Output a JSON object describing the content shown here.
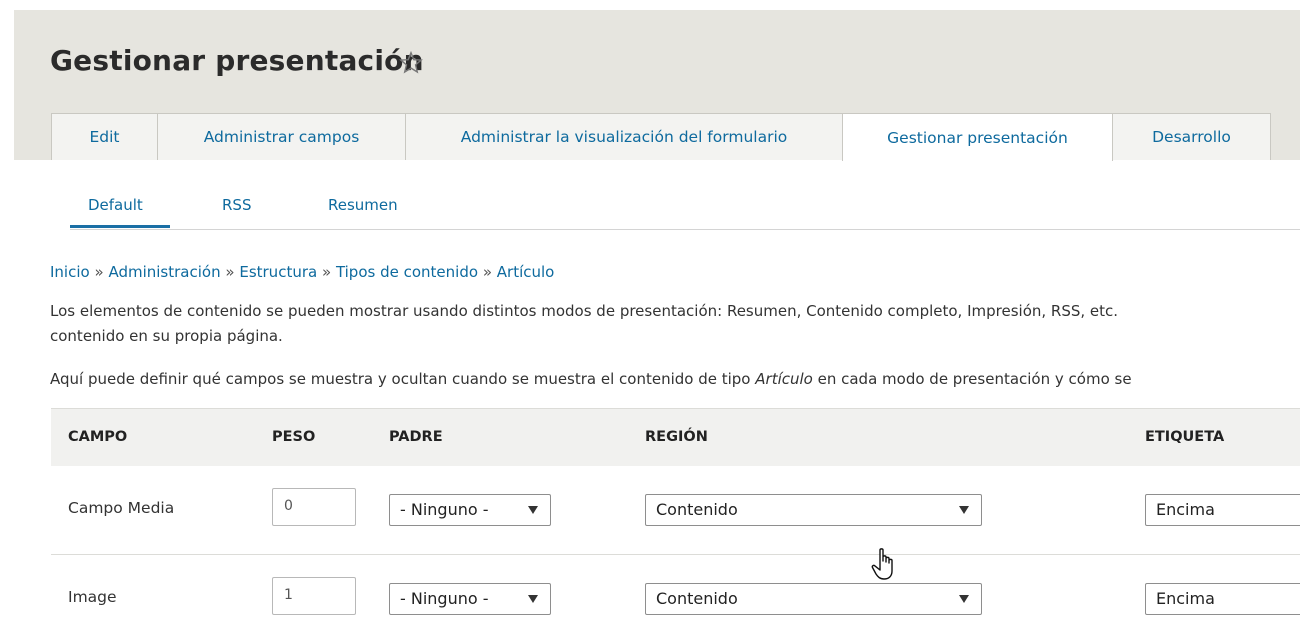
{
  "page": {
    "title": "Gestionar presentación",
    "star_icon": "star-outline-icon"
  },
  "tabs": [
    {
      "label": "Edit"
    },
    {
      "label": "Administrar campos"
    },
    {
      "label": "Administrar la visualización del formulario"
    },
    {
      "label": "Gestionar presentación",
      "active": true
    },
    {
      "label": "Desarrollo"
    }
  ],
  "subtabs": [
    {
      "label": "Default",
      "active": true
    },
    {
      "label": "RSS"
    },
    {
      "label": "Resumen"
    }
  ],
  "breadcrumb": {
    "items": [
      "Inicio",
      "Administración",
      "Estructura",
      "Tipos de contenido",
      "Artículo"
    ],
    "separator": "»"
  },
  "description": {
    "line1": "Los elementos de contenido se pueden mostrar usando distintos modos de presentación: Resumen, Contenido completo, Impresión, RSS, etc.",
    "line2": "contenido en su propia página.",
    "line3_before": "Aquí puede definir qué campos se muestra y ocultan cuando se muestra el contenido de tipo ",
    "line3_em": "Artículo",
    "line3_after": " en cada modo de presentación y cómo se"
  },
  "table": {
    "headers": {
      "campo": "CAMPO",
      "peso": "PESO",
      "padre": "PADRE",
      "region": "REGIÓN",
      "etiqueta": "ETIQUETA"
    },
    "rows": [
      {
        "campo": "Campo Media",
        "peso": "0",
        "padre": "- Ninguno -",
        "region": "Contenido",
        "etiqueta": "Encima"
      },
      {
        "campo": "Image",
        "peso": "1",
        "padre": "- Ninguno -",
        "region": "Contenido",
        "etiqueta": "Encima"
      }
    ]
  },
  "colors": {
    "header_bg": "#e6e5df",
    "link": "#0e6a9e",
    "active_underline": "#1a6fa5"
  }
}
